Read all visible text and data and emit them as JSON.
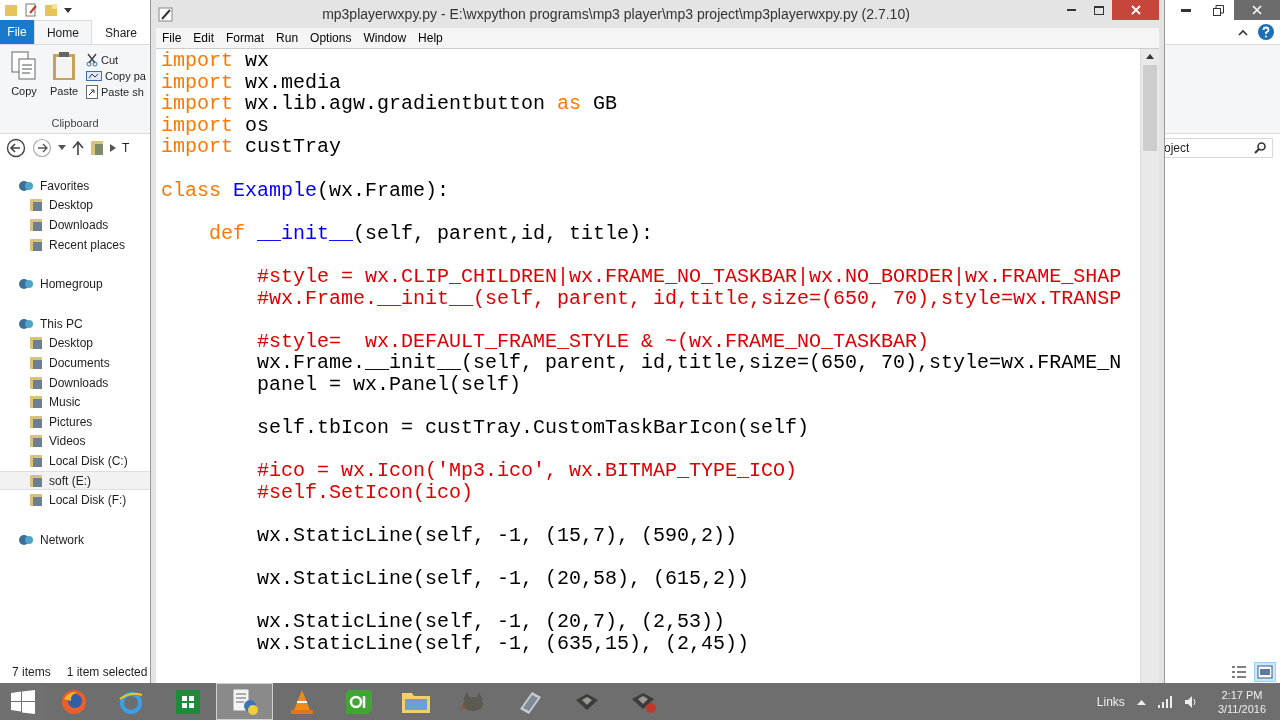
{
  "explorer": {
    "file_button": "File",
    "tabs": [
      {
        "label": "Home",
        "selected": true
      },
      {
        "label": "Share",
        "selected": false
      }
    ],
    "ribbon": {
      "large_buttons": [
        "Copy",
        "Paste"
      ],
      "small_buttons": [
        "Cut",
        "Copy pa",
        "Paste sh"
      ],
      "group_label": "Clipboard"
    },
    "address": {
      "segment": "T"
    },
    "search": {
      "value": "oject"
    },
    "nav_tree": [
      {
        "label": "Favorites",
        "selected": false,
        "children": [
          {
            "label": "Desktop",
            "selected": false
          },
          {
            "label": "Downloads",
            "selected": false
          },
          {
            "label": "Recent places",
            "selected": false
          }
        ]
      },
      {
        "label": "Homegroup",
        "selected": false
      },
      {
        "label": "This PC",
        "selected": false,
        "children": [
          {
            "label": "Desktop",
            "selected": false
          },
          {
            "label": "Documents",
            "selected": false
          },
          {
            "label": "Downloads",
            "selected": false
          },
          {
            "label": "Music",
            "selected": false
          },
          {
            "label": "Pictures",
            "selected": false
          },
          {
            "label": "Videos",
            "selected": false
          },
          {
            "label": "Local Disk (C:)",
            "selected": false
          },
          {
            "label": "soft (E:)",
            "selected": true
          },
          {
            "label": "Local Disk (F:)",
            "selected": false
          }
        ]
      },
      {
        "label": "Network",
        "selected": false
      }
    ],
    "status_bar": {
      "item_count": "7 items",
      "selection": "1 item selected"
    },
    "views": [
      {
        "selected": false
      },
      {
        "selected": true
      }
    ]
  },
  "editor": {
    "title": "mp3playerwxpy.py - E:\\wxpython programs\\mp3 player\\mp3 project\\mp3playerwxpy.py (2.7.10)",
    "menu": [
      "File",
      "Edit",
      "Format",
      "Run",
      "Options",
      "Window",
      "Help"
    ],
    "code": [
      {
        "kind": "code",
        "tokens": [
          {
            "kind": "keyword",
            "text": "import"
          },
          {
            "kind": "plain",
            "text": " wx"
          }
        ]
      },
      {
        "kind": "code",
        "tokens": [
          {
            "kind": "keyword",
            "text": "import"
          },
          {
            "kind": "plain",
            "text": " wx.media"
          }
        ]
      },
      {
        "kind": "code",
        "tokens": [
          {
            "kind": "keyword",
            "text": "import"
          },
          {
            "kind": "plain",
            "text": " wx.lib.agw.gradientbutton "
          },
          {
            "kind": "keyword",
            "text": "as"
          },
          {
            "kind": "plain",
            "text": " GB"
          }
        ]
      },
      {
        "kind": "code",
        "tokens": [
          {
            "kind": "keyword",
            "text": "import"
          },
          {
            "kind": "plain",
            "text": " os"
          }
        ]
      },
      {
        "kind": "code",
        "tokens": [
          {
            "kind": "keyword",
            "text": "import"
          },
          {
            "kind": "plain",
            "text": " custTray"
          }
        ]
      },
      {
        "kind": "blank"
      },
      {
        "kind": "code",
        "tokens": [
          {
            "kind": "keyword",
            "text": "class "
          },
          {
            "kind": "definition",
            "text": "Example"
          },
          {
            "kind": "plain",
            "text": "(wx.Frame):"
          }
        ],
        "children": [
          {
            "kind": "blank"
          },
          {
            "kind": "code",
            "tokens": [
              {
                "kind": "keyword",
                "text": "def "
              },
              {
                "kind": "definition",
                "text": "__init__"
              },
              {
                "kind": "plain",
                "text": "(self, parent,id, title):"
              }
            ],
            "children": [
              {
                "kind": "blank"
              },
              {
                "kind": "code",
                "tokens": [
                  {
                    "kind": "comment",
                    "text": "#style = wx.CLIP_CHILDREN|wx.FRAME_NO_TASKBAR|wx.NO_BORDER|wx.FRAME_SHAP"
                  }
                ]
              },
              {
                "kind": "code",
                "tokens": [
                  {
                    "kind": "comment",
                    "text": "#wx.Frame.__init__(self, parent, id,title,size=(650, 70),style=wx.TRANSP"
                  }
                ]
              },
              {
                "kind": "blank"
              },
              {
                "kind": "code",
                "tokens": [
                  {
                    "kind": "comment",
                    "text": "#style=  wx.DEFAULT_FRAME_STYLE & ~(wx.FRAME_NO_TASKBAR)"
                  }
                ]
              },
              {
                "kind": "code",
                "tokens": [
                  {
                    "kind": "plain",
                    "text": "wx.Frame.__init__(self, parent, id,title,size=(650, 70),style=wx.FRAME_N"
                  }
                ]
              },
              {
                "kind": "code",
                "tokens": [
                  {
                    "kind": "plain",
                    "text": "panel = wx.Panel(self)"
                  }
                ]
              },
              {
                "kind": "blank"
              },
              {
                "kind": "code",
                "tokens": [
                  {
                    "kind": "plain",
                    "text": "self.tbIcon = custTray.CustomTaskBarIcon(self)"
                  }
                ]
              },
              {
                "kind": "blank"
              },
              {
                "kind": "code",
                "tokens": [
                  {
                    "kind": "comment",
                    "text": "#ico = wx.Icon('Mp3.ico', wx.BITMAP_TYPE_ICO)"
                  }
                ]
              },
              {
                "kind": "code",
                "tokens": [
                  {
                    "kind": "comment",
                    "text": "#self.SetIcon(ico)"
                  }
                ]
              },
              {
                "kind": "blank"
              },
              {
                "kind": "code",
                "tokens": [
                  {
                    "kind": "plain",
                    "text": "wx.StaticLine(self, -1, (15,7), (590,2))"
                  }
                ]
              },
              {
                "kind": "blank"
              },
              {
                "kind": "code",
                "tokens": [
                  {
                    "kind": "plain",
                    "text": "wx.StaticLine(self, -1, (20,58), (615,2))"
                  }
                ]
              },
              {
                "kind": "blank"
              },
              {
                "kind": "code",
                "tokens": [
                  {
                    "kind": "plain",
                    "text": "wx.StaticLine(self, -1, (20,7), (2,53))"
                  }
                ]
              },
              {
                "kind": "code",
                "tokens": [
                  {
                    "kind": "plain",
                    "text": "wx.StaticLine(self, -1, (635,15), (2,45))"
                  }
                ]
              }
            ]
          }
        ]
      }
    ]
  },
  "taskbar": {
    "apps": [
      {
        "selected": false
      },
      {
        "selected": false
      },
      {
        "selected": false
      },
      {
        "selected": true
      },
      {
        "selected": false
      },
      {
        "selected": false
      },
      {
        "selected": false
      },
      {
        "selected": false
      },
      {
        "selected": false
      },
      {
        "selected": false
      },
      {
        "selected": false
      }
    ],
    "tray": {
      "links": "Links",
      "time": "2:17 PM",
      "date": "3/11/2016"
    }
  }
}
